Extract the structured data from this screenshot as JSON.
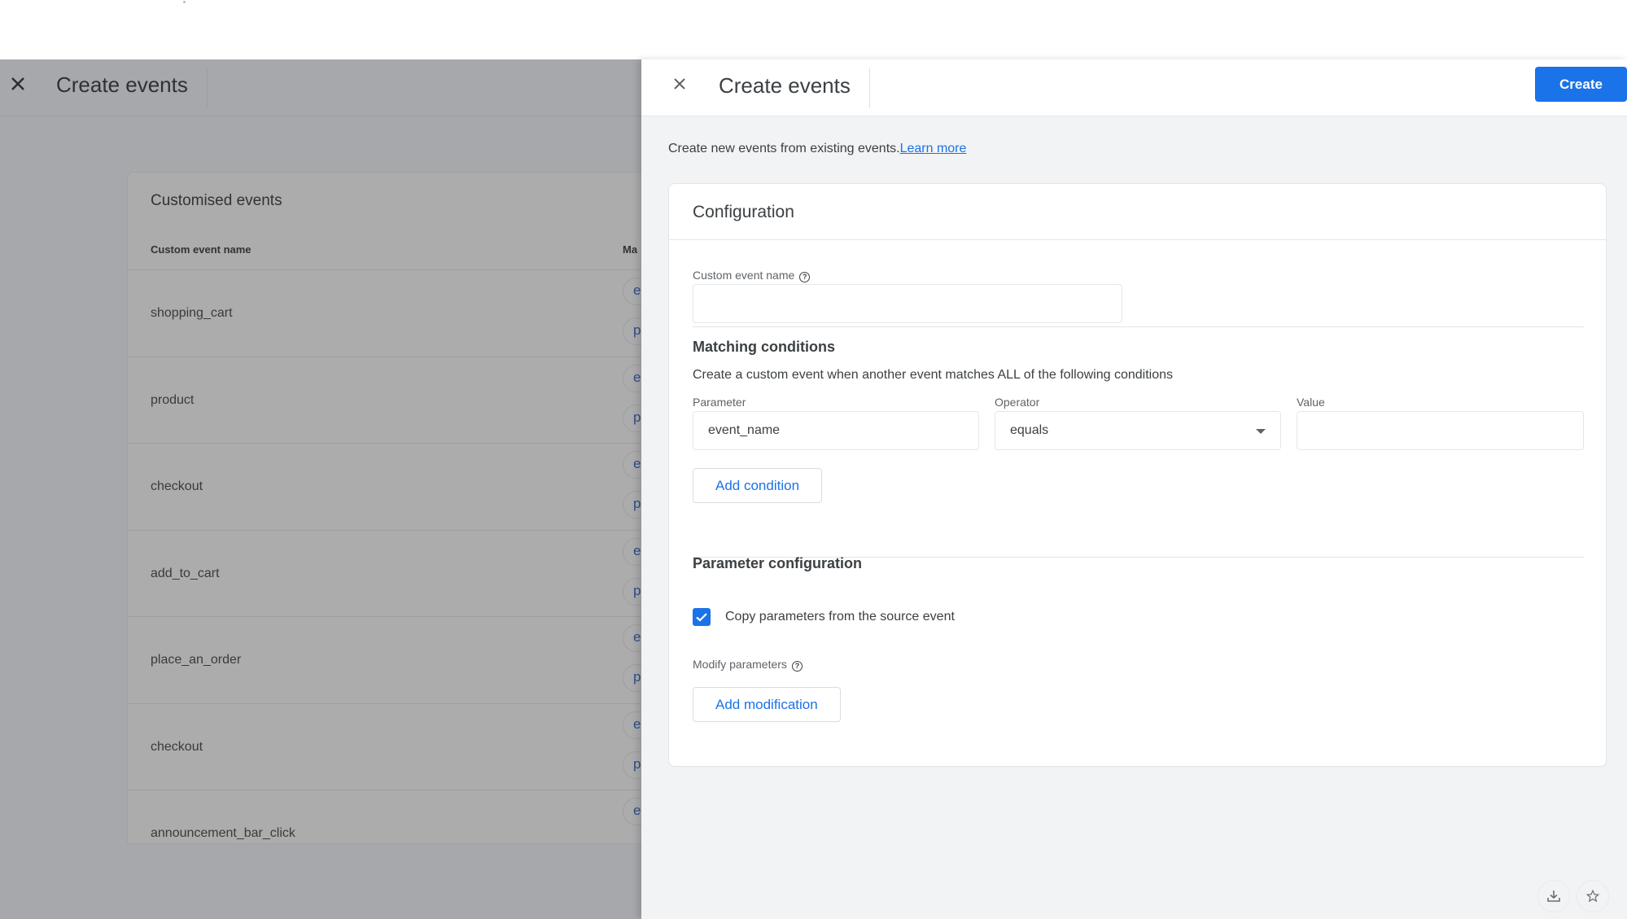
{
  "background_page": {
    "title": "Create events",
    "close_icon": "close-icon",
    "card": {
      "title": "Customised events",
      "columns": [
        "Custom event name",
        "Ma"
      ],
      "rows": [
        {
          "name": "shopping_cart",
          "chips": [
            "e",
            "p"
          ]
        },
        {
          "name": "product",
          "chips": [
            "e",
            "p"
          ]
        },
        {
          "name": "checkout",
          "chips": [
            "e",
            "p"
          ]
        },
        {
          "name": "add_to_cart",
          "chips": [
            "e",
            "p"
          ]
        },
        {
          "name": "place_an_order",
          "chips": [
            "e",
            "p"
          ]
        },
        {
          "name": "checkout",
          "chips": [
            "e",
            "p"
          ]
        },
        {
          "name": "announcement_bar_click",
          "chips": [
            "e"
          ]
        }
      ]
    }
  },
  "drawer": {
    "title": "Create events",
    "close_icon": "close-icon",
    "create_label": "Create",
    "intro_text": "Create new events from existing events.",
    "learn_more_label": "Learn more",
    "configuration": {
      "title": "Configuration",
      "custom_event_name": {
        "label": "Custom event name",
        "value": "",
        "help_icon": "help-circle-icon"
      },
      "matching_conditions": {
        "title": "Matching conditions",
        "description": "Create a custom event when another event matches ALL of the following conditions",
        "parameter_label": "Parameter",
        "parameter_value": "event_name",
        "operator_label": "Operator",
        "operator_value": "equals",
        "value_label": "Value",
        "value_value": "",
        "add_condition_label": "Add condition"
      },
      "parameter_configuration": {
        "title": "Parameter configuration",
        "copy_params_label": "Copy parameters from the source event",
        "copy_params_checked": true,
        "modify_params_label": "Modify parameters",
        "add_modification_label": "Add modification"
      }
    }
  },
  "floating_buttons": [
    "download-icon",
    "star-icon"
  ],
  "colors": {
    "primary": "#1a73e8",
    "scrim": "#a6a8ab",
    "drawer_bg": "#f1f3f4"
  }
}
